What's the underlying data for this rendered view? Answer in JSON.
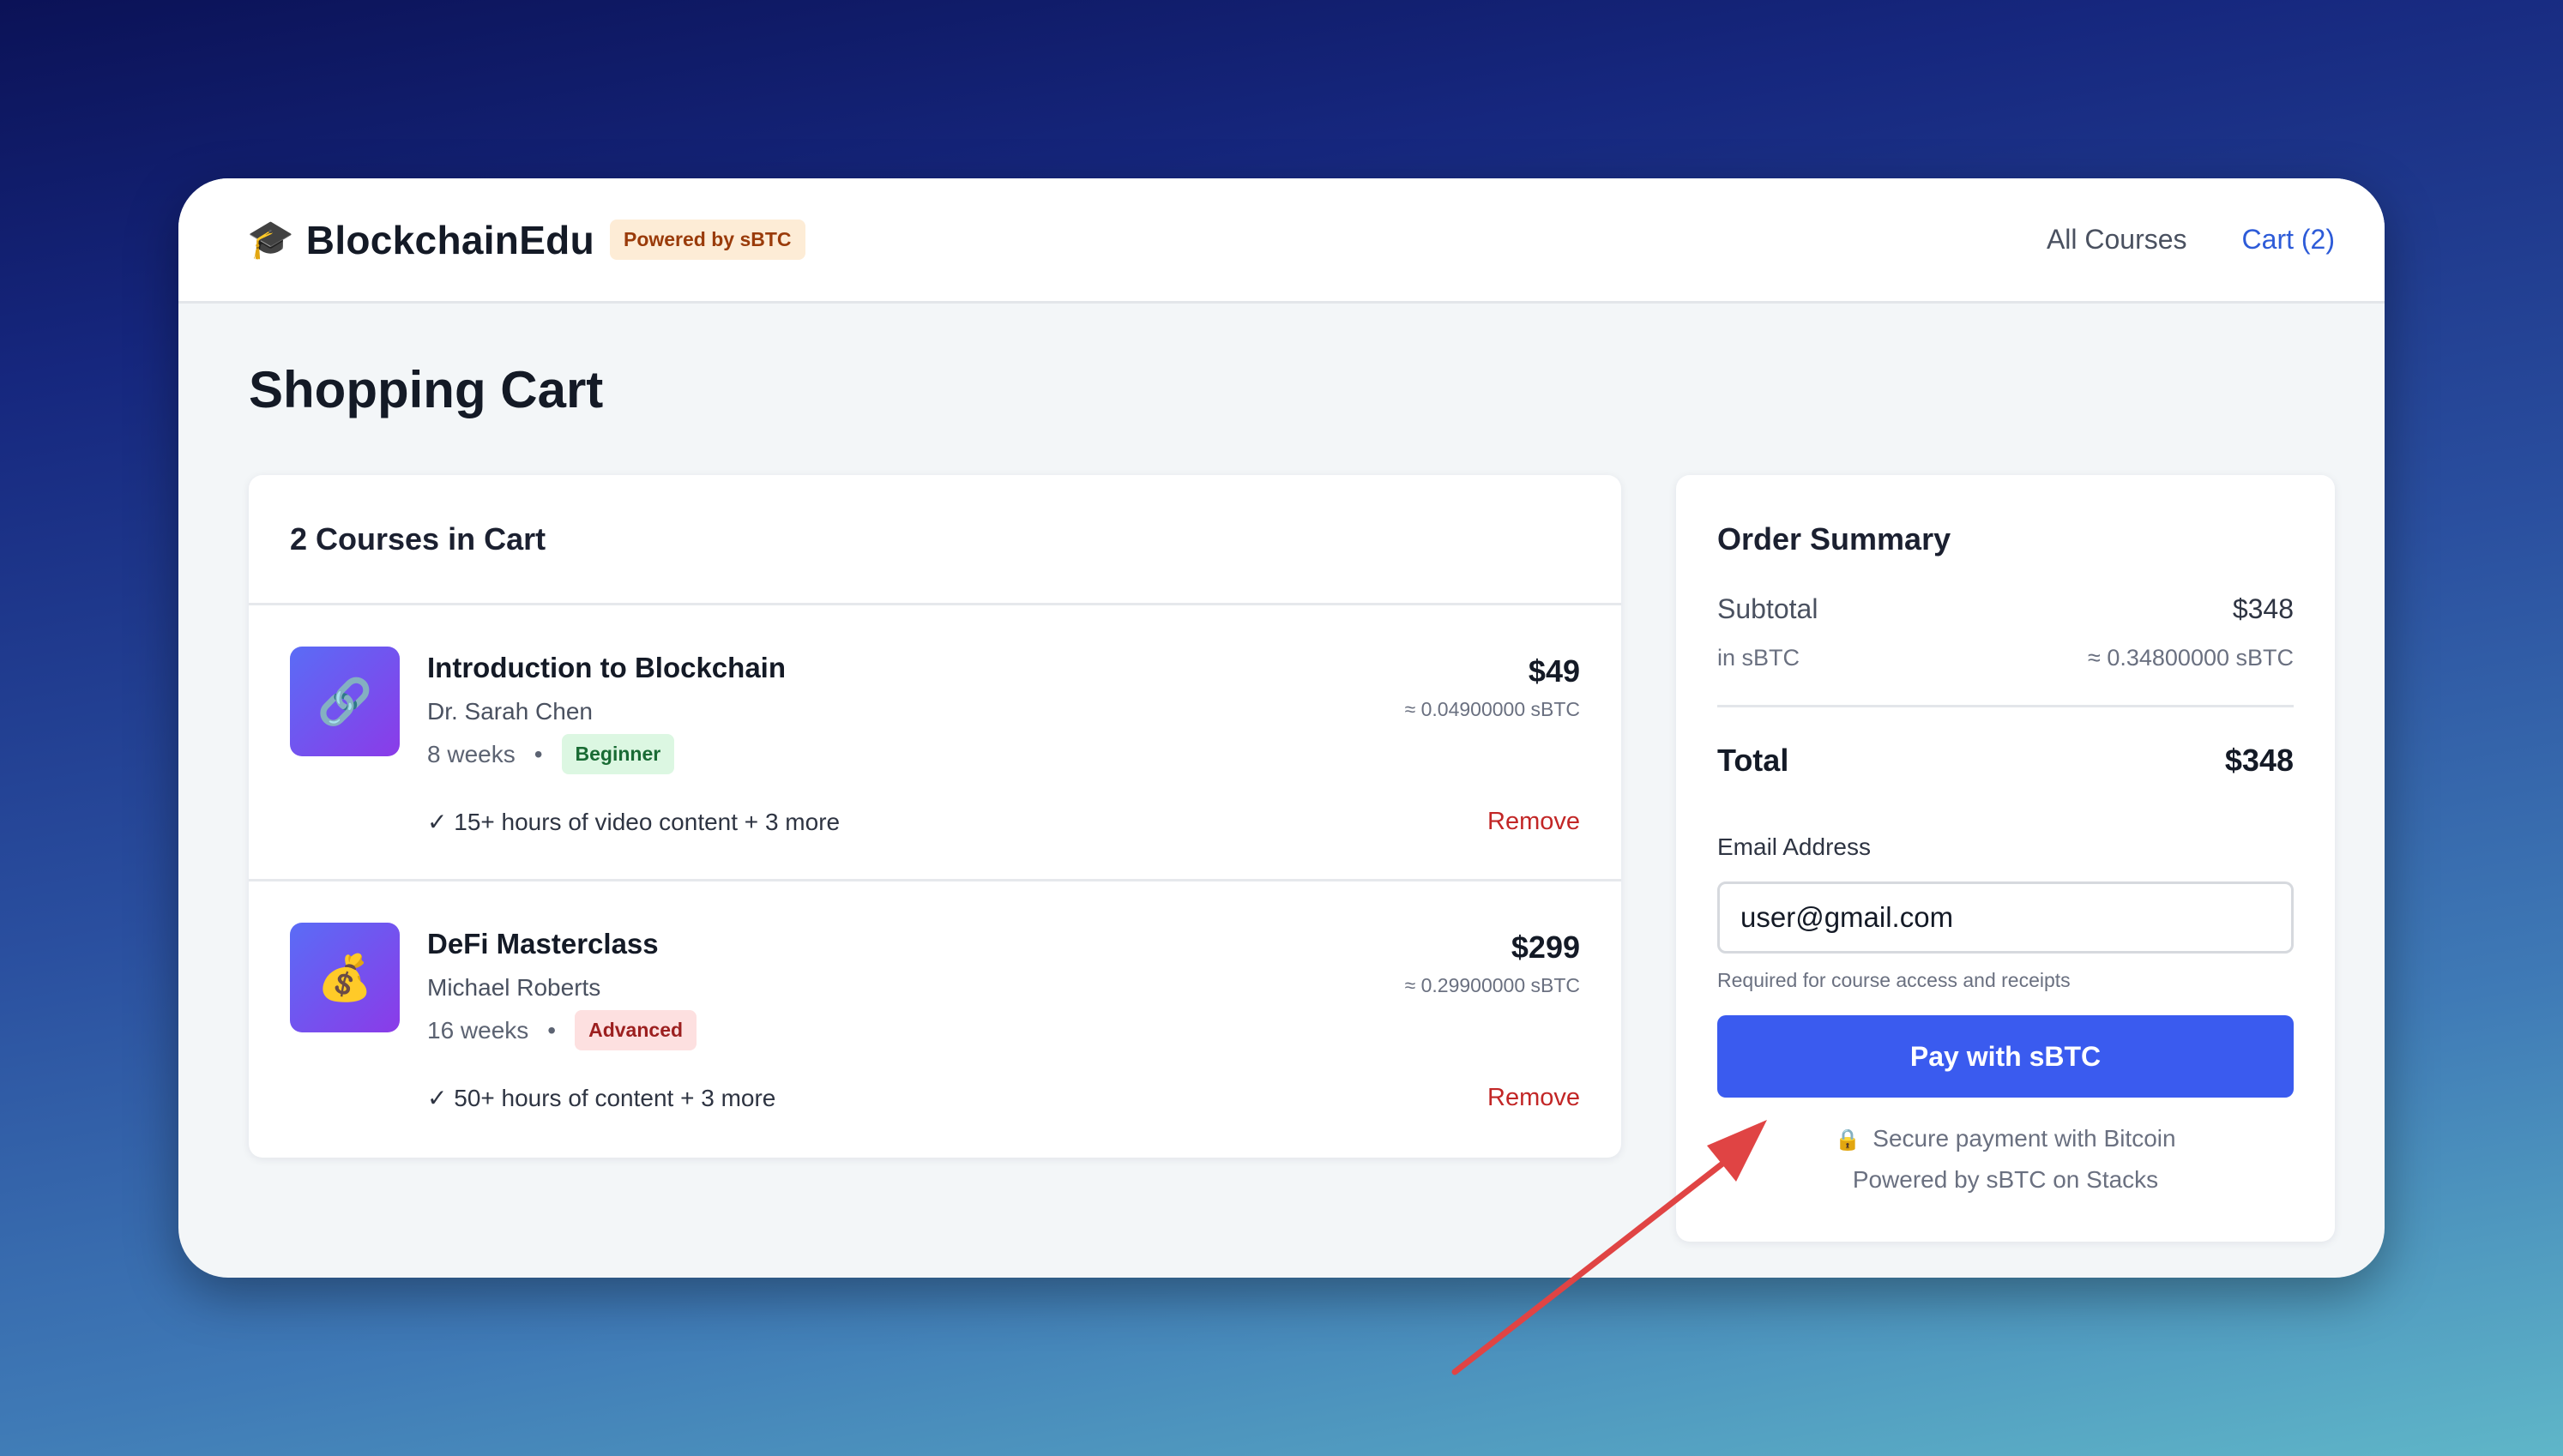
{
  "header": {
    "brand_icon": "graduation-cap",
    "brand_name": "BlockchainEdu",
    "badge": "Powered by sBTC",
    "nav": {
      "all_courses": "All Courses",
      "cart": "Cart (2)"
    }
  },
  "page_title": "Shopping Cart",
  "cart": {
    "heading": "2 Courses in Cart",
    "items": [
      {
        "icon": "🔗",
        "title": "Introduction to Blockchain",
        "author": "Dr. Sarah Chen",
        "duration": "8 weeks",
        "separator": "•",
        "level": "Beginner",
        "feature": "✓ 15+ hours of video content + 3 more",
        "price": "$49",
        "sbtc": "≈ 0.04900000 sBTC",
        "remove": "Remove"
      },
      {
        "icon": "💰",
        "title": "DeFi Masterclass",
        "author": "Michael Roberts",
        "duration": "16 weeks",
        "separator": "•",
        "level": "Advanced",
        "feature": "✓ 50+ hours of content + 3 more",
        "price": "$299",
        "sbtc": "≈ 0.29900000 sBTC",
        "remove": "Remove"
      }
    ]
  },
  "summary": {
    "title": "Order Summary",
    "subtotal_label": "Subtotal",
    "subtotal_value": "$348",
    "insbtc_label": "in sBTC",
    "insbtc_value": "≈ 0.34800000 sBTC",
    "total_label": "Total",
    "total_value": "$348",
    "email_label": "Email Address",
    "email_value": "user@gmail.com",
    "email_help": "Required for course access and receipts",
    "pay_button": "Pay with sBTC",
    "secure_text": "Secure payment with Bitcoin",
    "powered_text": "Powered by sBTC on Stacks"
  },
  "colors": {
    "accent": "#3a5bef",
    "link": "#2d5bd8",
    "remove": "#c22626",
    "annotation_arrow": "#e04444"
  }
}
